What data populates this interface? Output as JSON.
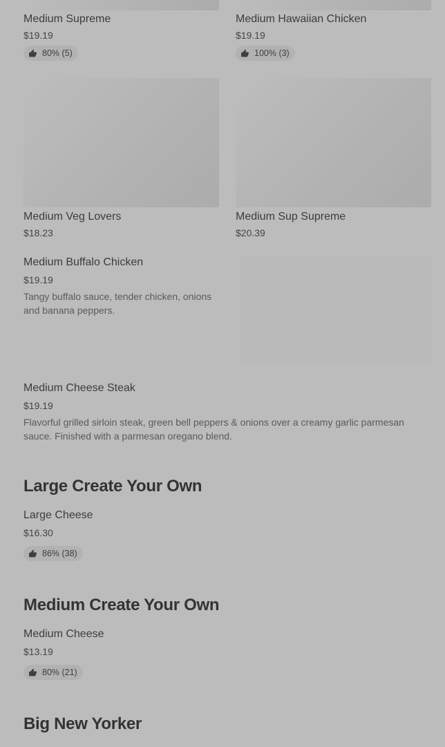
{
  "menu": {
    "row1": [
      {
        "name": "Medium Supreme",
        "price": "$19.19",
        "rating": "80% (5)"
      },
      {
        "name": "Medium Hawaiian Chicken",
        "price": "$19.19",
        "rating": "100% (3)"
      }
    ],
    "row2": [
      {
        "name": "Medium Veg Lovers",
        "price": "$18.23"
      },
      {
        "name": "Medium Sup Supreme",
        "price": "$20.39"
      }
    ],
    "buffalo": {
      "name": "Medium Buffalo Chicken",
      "price": "$19.19",
      "description": "Tangy buffalo sauce, tender chicken, onions and banana peppers."
    },
    "cheese_steak": {
      "name": "Medium Cheese Steak",
      "price": "$19.19",
      "description": "Flavorful grilled sirloin steak, green bell peppers & onions over a creamy garlic parmesan sauce. Finished with a parmesan oregano blend."
    }
  },
  "sections": [
    {
      "title": "Large Create Your Own",
      "item": {
        "name": "Large Cheese",
        "price": "$16.30",
        "rating": "86% (38)"
      }
    },
    {
      "title": "Medium Create Your Own",
      "item": {
        "name": "Medium Cheese",
        "price": "$13.19",
        "rating": "80% (21)"
      }
    },
    {
      "title": "Big New Yorker"
    }
  ],
  "icons": {
    "rating": "thumbs-up-icon"
  },
  "colors": {
    "background": "#bcbcbc",
    "badge": "#b2b2b2",
    "image_placeholder": "#b5b5b5"
  }
}
